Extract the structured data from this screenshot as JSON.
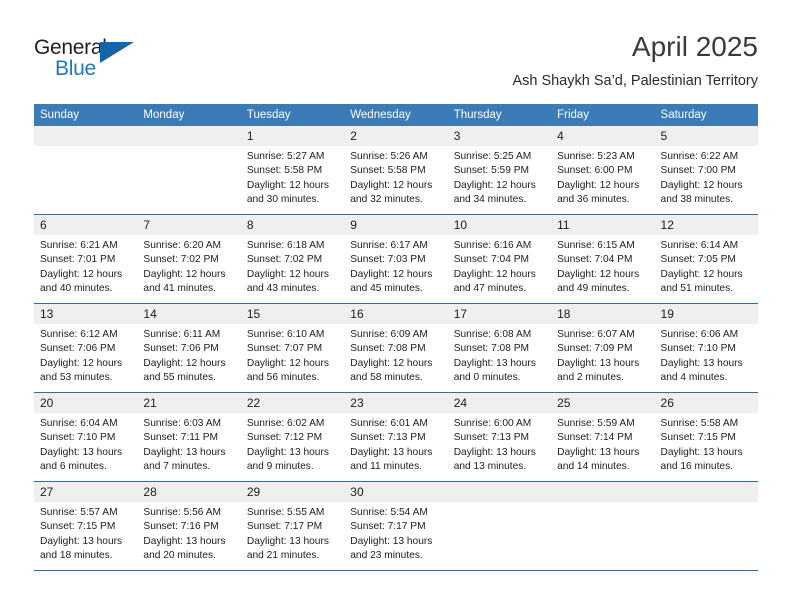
{
  "logo": {
    "word_one": "General",
    "word_two": "Blue",
    "triangle_icon": "triangle-icon",
    "colors": {
      "dark": "#231f20",
      "blue": "#1f77c4",
      "triangle": "#1464ab"
    }
  },
  "header": {
    "month_year": "April 2025",
    "location": "Ash Shaykh Sa’d, Palestinian Territory"
  },
  "calendar": {
    "header_bg": "#3b7cb8",
    "daynum_bg": "#efefef",
    "row_separator": "#2f6ca8",
    "weekday_headers": [
      "Sunday",
      "Monday",
      "Tuesday",
      "Wednesday",
      "Thursday",
      "Friday",
      "Saturday"
    ],
    "weeks": [
      [
        {
          "day": "",
          "lines": []
        },
        {
          "day": "",
          "lines": []
        },
        {
          "day": "1",
          "lines": [
            "Sunrise: 5:27 AM",
            "Sunset: 5:58 PM",
            "Daylight: 12 hours",
            "and 30 minutes."
          ]
        },
        {
          "day": "2",
          "lines": [
            "Sunrise: 5:26 AM",
            "Sunset: 5:58 PM",
            "Daylight: 12 hours",
            "and 32 minutes."
          ]
        },
        {
          "day": "3",
          "lines": [
            "Sunrise: 5:25 AM",
            "Sunset: 5:59 PM",
            "Daylight: 12 hours",
            "and 34 minutes."
          ]
        },
        {
          "day": "4",
          "lines": [
            "Sunrise: 5:23 AM",
            "Sunset: 6:00 PM",
            "Daylight: 12 hours",
            "and 36 minutes."
          ]
        },
        {
          "day": "5",
          "lines": [
            "Sunrise: 6:22 AM",
            "Sunset: 7:00 PM",
            "Daylight: 12 hours",
            "and 38 minutes."
          ]
        }
      ],
      [
        {
          "day": "6",
          "lines": [
            "Sunrise: 6:21 AM",
            "Sunset: 7:01 PM",
            "Daylight: 12 hours",
            "and 40 minutes."
          ]
        },
        {
          "day": "7",
          "lines": [
            "Sunrise: 6:20 AM",
            "Sunset: 7:02 PM",
            "Daylight: 12 hours",
            "and 41 minutes."
          ]
        },
        {
          "day": "8",
          "lines": [
            "Sunrise: 6:18 AM",
            "Sunset: 7:02 PM",
            "Daylight: 12 hours",
            "and 43 minutes."
          ]
        },
        {
          "day": "9",
          "lines": [
            "Sunrise: 6:17 AM",
            "Sunset: 7:03 PM",
            "Daylight: 12 hours",
            "and 45 minutes."
          ]
        },
        {
          "day": "10",
          "lines": [
            "Sunrise: 6:16 AM",
            "Sunset: 7:04 PM",
            "Daylight: 12 hours",
            "and 47 minutes."
          ]
        },
        {
          "day": "11",
          "lines": [
            "Sunrise: 6:15 AM",
            "Sunset: 7:04 PM",
            "Daylight: 12 hours",
            "and 49 minutes."
          ]
        },
        {
          "day": "12",
          "lines": [
            "Sunrise: 6:14 AM",
            "Sunset: 7:05 PM",
            "Daylight: 12 hours",
            "and 51 minutes."
          ]
        }
      ],
      [
        {
          "day": "13",
          "lines": [
            "Sunrise: 6:12 AM",
            "Sunset: 7:06 PM",
            "Daylight: 12 hours",
            "and 53 minutes."
          ]
        },
        {
          "day": "14",
          "lines": [
            "Sunrise: 6:11 AM",
            "Sunset: 7:06 PM",
            "Daylight: 12 hours",
            "and 55 minutes."
          ]
        },
        {
          "day": "15",
          "lines": [
            "Sunrise: 6:10 AM",
            "Sunset: 7:07 PM",
            "Daylight: 12 hours",
            "and 56 minutes."
          ]
        },
        {
          "day": "16",
          "lines": [
            "Sunrise: 6:09 AM",
            "Sunset: 7:08 PM",
            "Daylight: 12 hours",
            "and 58 minutes."
          ]
        },
        {
          "day": "17",
          "lines": [
            "Sunrise: 6:08 AM",
            "Sunset: 7:08 PM",
            "Daylight: 13 hours",
            "and 0 minutes."
          ]
        },
        {
          "day": "18",
          "lines": [
            "Sunrise: 6:07 AM",
            "Sunset: 7:09 PM",
            "Daylight: 13 hours",
            "and 2 minutes."
          ]
        },
        {
          "day": "19",
          "lines": [
            "Sunrise: 6:06 AM",
            "Sunset: 7:10 PM",
            "Daylight: 13 hours",
            "and 4 minutes."
          ]
        }
      ],
      [
        {
          "day": "20",
          "lines": [
            "Sunrise: 6:04 AM",
            "Sunset: 7:10 PM",
            "Daylight: 13 hours",
            "and 6 minutes."
          ]
        },
        {
          "day": "21",
          "lines": [
            "Sunrise: 6:03 AM",
            "Sunset: 7:11 PM",
            "Daylight: 13 hours",
            "and 7 minutes."
          ]
        },
        {
          "day": "22",
          "lines": [
            "Sunrise: 6:02 AM",
            "Sunset: 7:12 PM",
            "Daylight: 13 hours",
            "and 9 minutes."
          ]
        },
        {
          "day": "23",
          "lines": [
            "Sunrise: 6:01 AM",
            "Sunset: 7:13 PM",
            "Daylight: 13 hours",
            "and 11 minutes."
          ]
        },
        {
          "day": "24",
          "lines": [
            "Sunrise: 6:00 AM",
            "Sunset: 7:13 PM",
            "Daylight: 13 hours",
            "and 13 minutes."
          ]
        },
        {
          "day": "25",
          "lines": [
            "Sunrise: 5:59 AM",
            "Sunset: 7:14 PM",
            "Daylight: 13 hours",
            "and 14 minutes."
          ]
        },
        {
          "day": "26",
          "lines": [
            "Sunrise: 5:58 AM",
            "Sunset: 7:15 PM",
            "Daylight: 13 hours",
            "and 16 minutes."
          ]
        }
      ],
      [
        {
          "day": "27",
          "lines": [
            "Sunrise: 5:57 AM",
            "Sunset: 7:15 PM",
            "Daylight: 13 hours",
            "and 18 minutes."
          ]
        },
        {
          "day": "28",
          "lines": [
            "Sunrise: 5:56 AM",
            "Sunset: 7:16 PM",
            "Daylight: 13 hours",
            "and 20 minutes."
          ]
        },
        {
          "day": "29",
          "lines": [
            "Sunrise: 5:55 AM",
            "Sunset: 7:17 PM",
            "Daylight: 13 hours",
            "and 21 minutes."
          ]
        },
        {
          "day": "30",
          "lines": [
            "Sunrise: 5:54 AM",
            "Sunset: 7:17 PM",
            "Daylight: 13 hours",
            "and 23 minutes."
          ]
        },
        {
          "day": "",
          "lines": []
        },
        {
          "day": "",
          "lines": []
        },
        {
          "day": "",
          "lines": []
        }
      ]
    ]
  }
}
